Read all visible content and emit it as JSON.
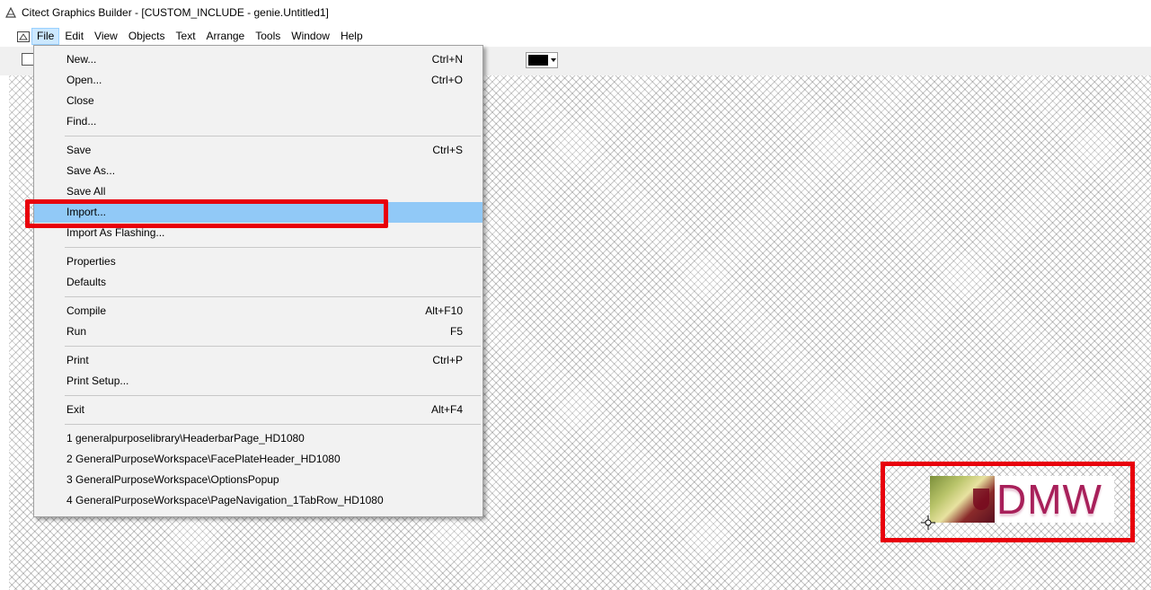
{
  "window": {
    "title": "Citect Graphics Builder - [CUSTOM_INCLUDE - genie.Untitled1]"
  },
  "menubar": {
    "items": [
      "File",
      "Edit",
      "View",
      "Objects",
      "Text",
      "Arrange",
      "Tools",
      "Window",
      "Help"
    ],
    "active": "File"
  },
  "toolbar": {
    "line_color": "#000000"
  },
  "file_menu": {
    "items": [
      {
        "label": "New...",
        "shortcut": "Ctrl+N"
      },
      {
        "label": "Open...",
        "shortcut": "Ctrl+O"
      },
      {
        "label": "Close",
        "shortcut": ""
      },
      {
        "label": "Find...",
        "shortcut": ""
      },
      {
        "label": "Save",
        "shortcut": "Ctrl+S"
      },
      {
        "label": "Save As...",
        "shortcut": ""
      },
      {
        "label": "Save All",
        "shortcut": ""
      },
      {
        "label": "Import...",
        "shortcut": ""
      },
      {
        "label": "Import As Flashing...",
        "shortcut": ""
      },
      {
        "label": "Properties",
        "shortcut": ""
      },
      {
        "label": "Defaults",
        "shortcut": ""
      },
      {
        "label": "Compile",
        "shortcut": "Alt+F10"
      },
      {
        "label": "Run",
        "shortcut": "F5"
      },
      {
        "label": "Print",
        "shortcut": "Ctrl+P"
      },
      {
        "label": "Print Setup...",
        "shortcut": ""
      },
      {
        "label": "Exit",
        "shortcut": "Alt+F4"
      },
      {
        "label": "1 generalpurposelibrary\\HeaderbarPage_HD1080",
        "shortcut": ""
      },
      {
        "label": "2 GeneralPurposeWorkspace\\FacePlateHeader_HD1080",
        "shortcut": ""
      },
      {
        "label": "3 GeneralPurposeWorkspace\\OptionsPopup",
        "shortcut": ""
      },
      {
        "label": "4 GeneralPurposeWorkspace\\PageNavigation_1TabRow_HD1080",
        "shortcut": ""
      }
    ],
    "highlighted": "Import..."
  },
  "canvas": {
    "logo_text": "DMW"
  },
  "colors": {
    "highlight": "#91c9f7",
    "annotation": "#e8000b",
    "logo_text": "#a8205a"
  }
}
